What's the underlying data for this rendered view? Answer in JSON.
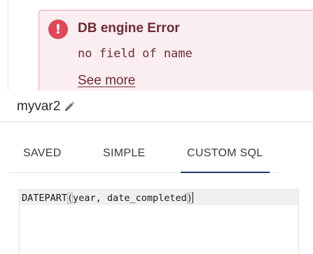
{
  "error": {
    "icon": "alert-circle-icon",
    "icon_glyph": "!",
    "title": "DB engine Error",
    "message": "no field of name",
    "see_more": "See more",
    "colors": {
      "background": "#fbeef0",
      "border": "#e7a3ad",
      "icon": "#e0475b",
      "text": "#6e2a35"
    }
  },
  "variable": {
    "name": "myvar2",
    "edit_icon": "pencil-icon"
  },
  "tabs": [
    {
      "label": "SAVED",
      "active": false
    },
    {
      "label": "SIMPLE",
      "active": false
    },
    {
      "label": "CUSTOM SQL",
      "active": true
    }
  ],
  "editor": {
    "fn_name": "DATEPART",
    "open_paren": "(",
    "args": "year, date_completed",
    "close_paren": ")"
  }
}
